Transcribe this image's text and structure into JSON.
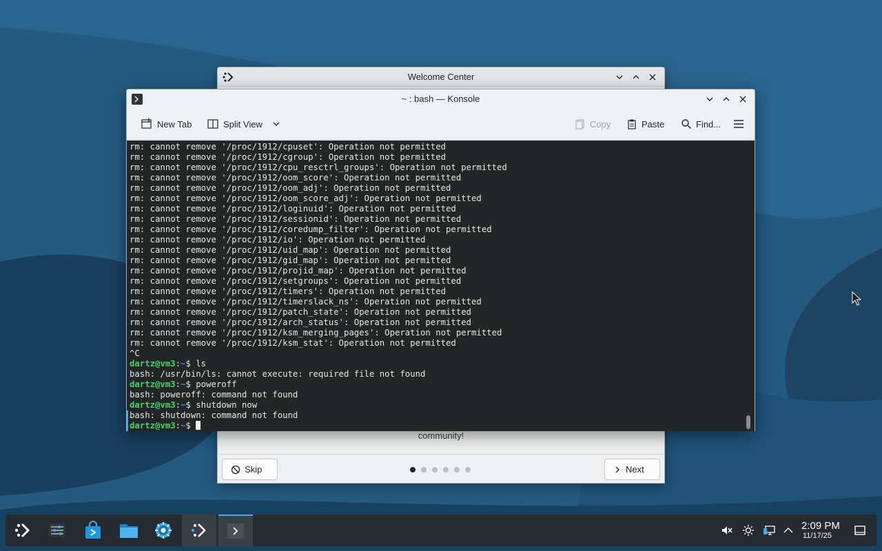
{
  "welcome_window": {
    "title": "Welcome Center",
    "partial_text": "community!",
    "skip_label": "Skip",
    "next_label": "Next",
    "page_count": 6,
    "current_page": 1
  },
  "konsole_window": {
    "title": "~ : bash — Konsole",
    "toolbar": {
      "new_tab": "New Tab",
      "split_view": "Split View",
      "copy": "Copy",
      "paste": "Paste",
      "find": "Find..."
    },
    "terminal_lines": [
      "rm: cannot remove '/proc/1912/cpuset': Operation not permitted",
      "rm: cannot remove '/proc/1912/cgroup': Operation not permitted",
      "rm: cannot remove '/proc/1912/cpu_resctrl_groups': Operation not permitted",
      "rm: cannot remove '/proc/1912/oom_score': Operation not permitted",
      "rm: cannot remove '/proc/1912/oom_adj': Operation not permitted",
      "rm: cannot remove '/proc/1912/oom_score_adj': Operation not permitted",
      "rm: cannot remove '/proc/1912/loginuid': Operation not permitted",
      "rm: cannot remove '/proc/1912/sessionid': Operation not permitted",
      "rm: cannot remove '/proc/1912/coredump_filter': Operation not permitted",
      "rm: cannot remove '/proc/1912/io': Operation not permitted",
      "rm: cannot remove '/proc/1912/uid_map': Operation not permitted",
      "rm: cannot remove '/proc/1912/gid_map': Operation not permitted",
      "rm: cannot remove '/proc/1912/projid_map': Operation not permitted",
      "rm: cannot remove '/proc/1912/setgroups': Operation not permitted",
      "rm: cannot remove '/proc/1912/timers': Operation not permitted",
      "rm: cannot remove '/proc/1912/timerslack_ns': Operation not permitted",
      "rm: cannot remove '/proc/1912/patch_state': Operation not permitted",
      "rm: cannot remove '/proc/1912/arch_status': Operation not permitted",
      "rm: cannot remove '/proc/1912/ksm_merging_pages': Operation not permitted",
      "rm: cannot remove '/proc/1912/ksm_stat': Operation not permitted",
      "^C"
    ],
    "prompt": {
      "user_host": "dartz@vm3",
      "path": "~",
      "symbol": "$"
    },
    "session": [
      {
        "command": "ls",
        "output": "bash: /usr/bin/ls: cannot execute: required file not found"
      },
      {
        "command": "poweroff",
        "output": "bash: poweroff: command not found"
      },
      {
        "command": "shutdown now",
        "output": "bash: shutdown: command not found"
      }
    ]
  },
  "taskbar": {
    "apps": [
      {
        "icon": "kde-app-launcher-icon"
      },
      {
        "icon": "system-monitor-icon"
      },
      {
        "icon": "discover-store-icon"
      },
      {
        "icon": "file-manager-icon"
      },
      {
        "icon": "system-settings-icon"
      },
      {
        "icon": "welcome-center-icon"
      },
      {
        "icon": "konsole-icon"
      }
    ],
    "tray": [
      "volume-muted-icon",
      "brightness-icon",
      "network-icon",
      "show-hidden-icon"
    ],
    "clock": {
      "time": "2:09 PM",
      "date": "11/17/25"
    }
  },
  "colors": {
    "wallpaper": "#1f4a6b",
    "accent": "#3daee9",
    "terminal_bg": "#232627",
    "prompt_user": "#3fd66b",
    "prompt_path": "#3f8ee6"
  }
}
